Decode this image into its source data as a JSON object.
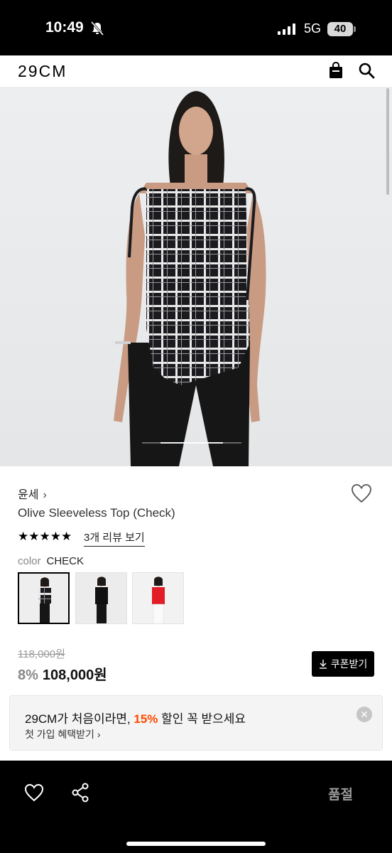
{
  "status": {
    "time": "10:49",
    "network": "5G",
    "battery": "40"
  },
  "header": {
    "logo": "29CM",
    "bag_icon": "shopping-bag-icon",
    "search_icon": "search-icon"
  },
  "product": {
    "brand": "윤세",
    "brand_chevron": "›",
    "name": "Olive Sleeveless Top (Check)",
    "stars": "★★★★★",
    "rating": 5,
    "review_link": "3개 리뷰 보기",
    "color_label": "color",
    "color_value": "CHECK",
    "swatches": [
      "check",
      "black",
      "red"
    ],
    "original_price": "118,000원",
    "discount": "8%",
    "price": "108,000원",
    "coupon_label": "쿠폰받기"
  },
  "promo": {
    "title_prefix": "29CM가 처음이라면, ",
    "title_pct": "15%",
    "title_suffix": " 할인 꼭 받으세요",
    "subtitle": "첫 가입 혜택받기 ›",
    "close": "✕"
  },
  "bottom_bar": {
    "soldout_label": "품절"
  },
  "colors": {
    "accent": "#ff4800",
    "primary": "#000000"
  }
}
